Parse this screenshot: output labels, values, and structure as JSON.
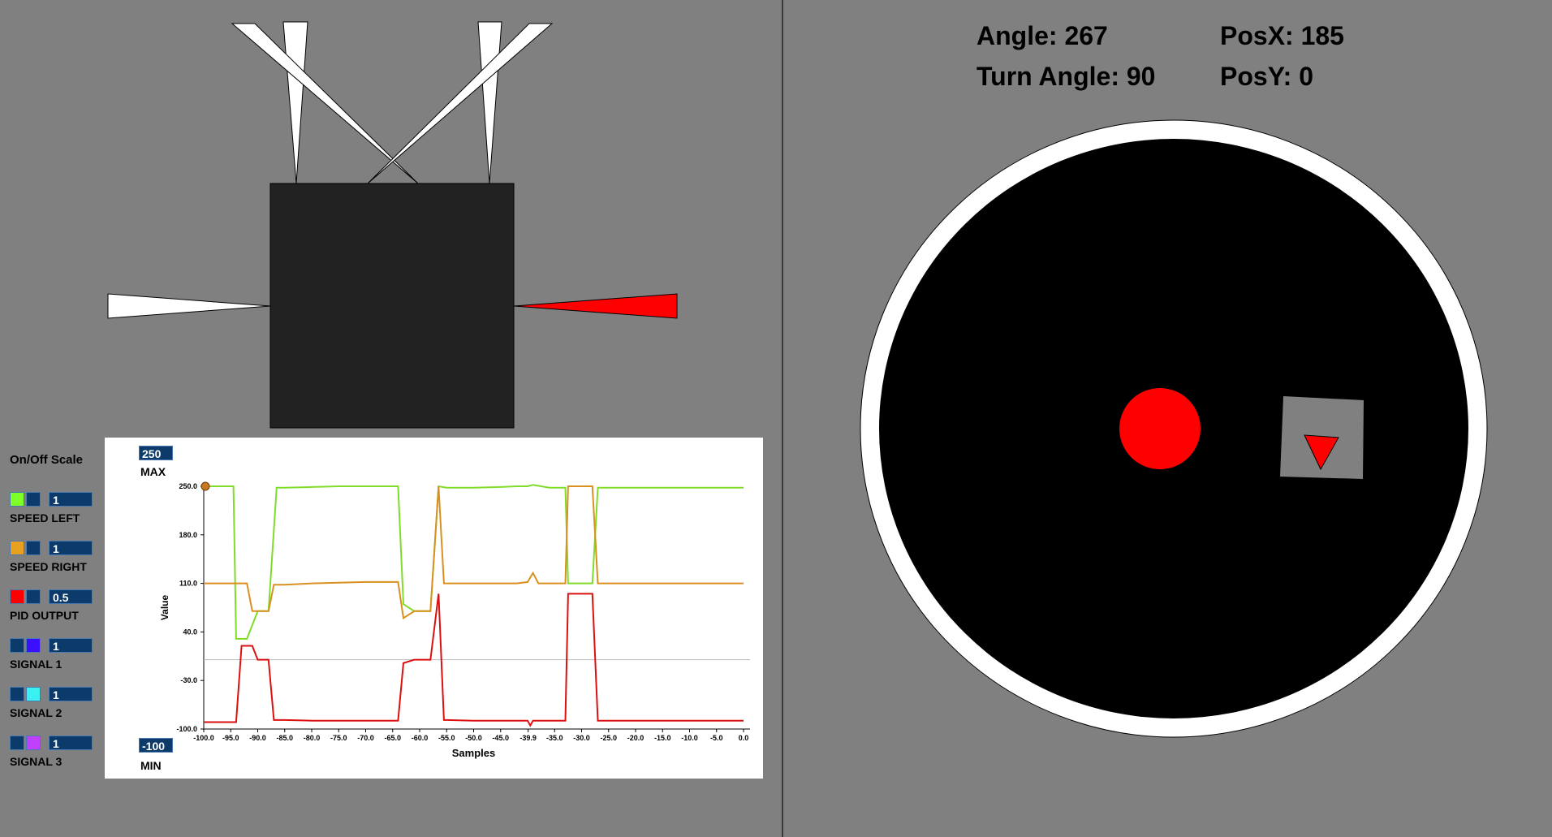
{
  "readouts": {
    "angle": "Angle: 267",
    "turn_angle": "Turn Angle: 90",
    "pos_x": "PosX: 185",
    "pos_y": "PosY: 0"
  },
  "legend": {
    "title": "On/Off Scale",
    "items": [
      {
        "name": "SPEED LEFT",
        "scale": "1",
        "color": "#7fff2a",
        "on": true
      },
      {
        "name": "SPEED RIGHT",
        "scale": "1",
        "color": "#e8a020",
        "on": true
      },
      {
        "name": "PID OUTPUT",
        "scale": "0.5",
        "color": "#ff0000",
        "on": true
      },
      {
        "name": "SIGNAL 1",
        "scale": "1",
        "color": "#3a10ff",
        "on": false
      },
      {
        "name": "SIGNAL 2",
        "scale": "1",
        "color": "#3af0f0",
        "on": false
      },
      {
        "name": "SIGNAL 3",
        "scale": "1",
        "color": "#c040ff",
        "on": false
      }
    ]
  },
  "chart": {
    "max_value": "250",
    "max_label": "MAX",
    "min_value": "-100",
    "min_label": "MIN"
  },
  "colors": {
    "background": "#808080",
    "robot_body": "#222222",
    "sensor_active": "#ff0000",
    "sensor_idle": "#ffffff",
    "arena": "#000000",
    "arena_border": "#ffffff",
    "target": "#ff0000"
  },
  "chart_data": {
    "type": "line",
    "xlabel": "Samples",
    "ylabel": "Value",
    "xlim": [
      -100,
      0
    ],
    "ylim": [
      -100,
      250
    ],
    "x_ticks": [
      "-100.0",
      "-95.0",
      "-90.0",
      "-85.0",
      "-80.0",
      "-75.0",
      "-70.0",
      "-65.0",
      "-60.0",
      "-55.0",
      "-50.0",
      "-45.0",
      "-39.9",
      "-35.0",
      "-30.0",
      "-25.0",
      "-20.0",
      "-15.0",
      "-10.0",
      "-5.0",
      "0.0"
    ],
    "y_ticks": [
      "250.0",
      "180.0",
      "110.0",
      "40.0",
      "-30.0",
      "-100.0"
    ],
    "zero_line": 0,
    "series": [
      {
        "name": "SPEED LEFT",
        "color": "#7fdd2a",
        "x": [
          -100,
          -94.5,
          -94,
          -92,
          -90,
          -88,
          -86.5,
          -85,
          -80,
          -75,
          -70,
          -64,
          -63,
          -61,
          -58,
          -56.5,
          -55,
          -50,
          -45,
          -42,
          -40,
          -39,
          -36,
          -33,
          -32.5,
          -30,
          -28,
          -27,
          -25,
          0
        ],
        "y": [
          250,
          250,
          30,
          30,
          70,
          70,
          248,
          248,
          249,
          250,
          250,
          250,
          80,
          70,
          70,
          250,
          248,
          248,
          249,
          250,
          250,
          252,
          248,
          248,
          110,
          110,
          110,
          248,
          248,
          248
        ]
      },
      {
        "name": "SPEED RIGHT",
        "color": "#d99020",
        "x": [
          -100,
          -94,
          -92,
          -91,
          -90,
          -88,
          -87,
          -85,
          -80,
          -70,
          -64,
          -63,
          -61,
          -58,
          -56.5,
          -55.5,
          -55,
          -50,
          -45,
          -42,
          -40,
          -39,
          -38,
          -36,
          -33,
          -32.5,
          -30,
          -28,
          -27,
          -25,
          0
        ],
        "y": [
          110,
          110,
          110,
          70,
          70,
          70,
          108,
          108,
          110,
          112,
          112,
          60,
          70,
          70,
          250,
          110,
          110,
          110,
          110,
          110,
          112,
          125,
          110,
          110,
          110,
          250,
          250,
          250,
          110,
          110,
          110
        ]
      },
      {
        "name": "PID OUTPUT",
        "color": "#dd1010",
        "x": [
          -100,
          -94,
          -93,
          -91,
          -90,
          -88,
          -87,
          -85,
          -80,
          -70,
          -64,
          -63,
          -61,
          -58,
          -56.5,
          -55.5,
          -55,
          -50,
          -45,
          -42,
          -40,
          -39.5,
          -39,
          -36,
          -33,
          -32.5,
          -30,
          -28,
          -27,
          -25,
          0
        ],
        "y": [
          -90,
          -90,
          20,
          20,
          0,
          0,
          -87,
          -87,
          -88,
          -88,
          -88,
          -5,
          0,
          0,
          95,
          -87,
          -87,
          -88,
          -88,
          -88,
          -88,
          -95,
          -88,
          -88,
          -88,
          95,
          95,
          95,
          -88,
          -88,
          -88
        ]
      }
    ]
  }
}
